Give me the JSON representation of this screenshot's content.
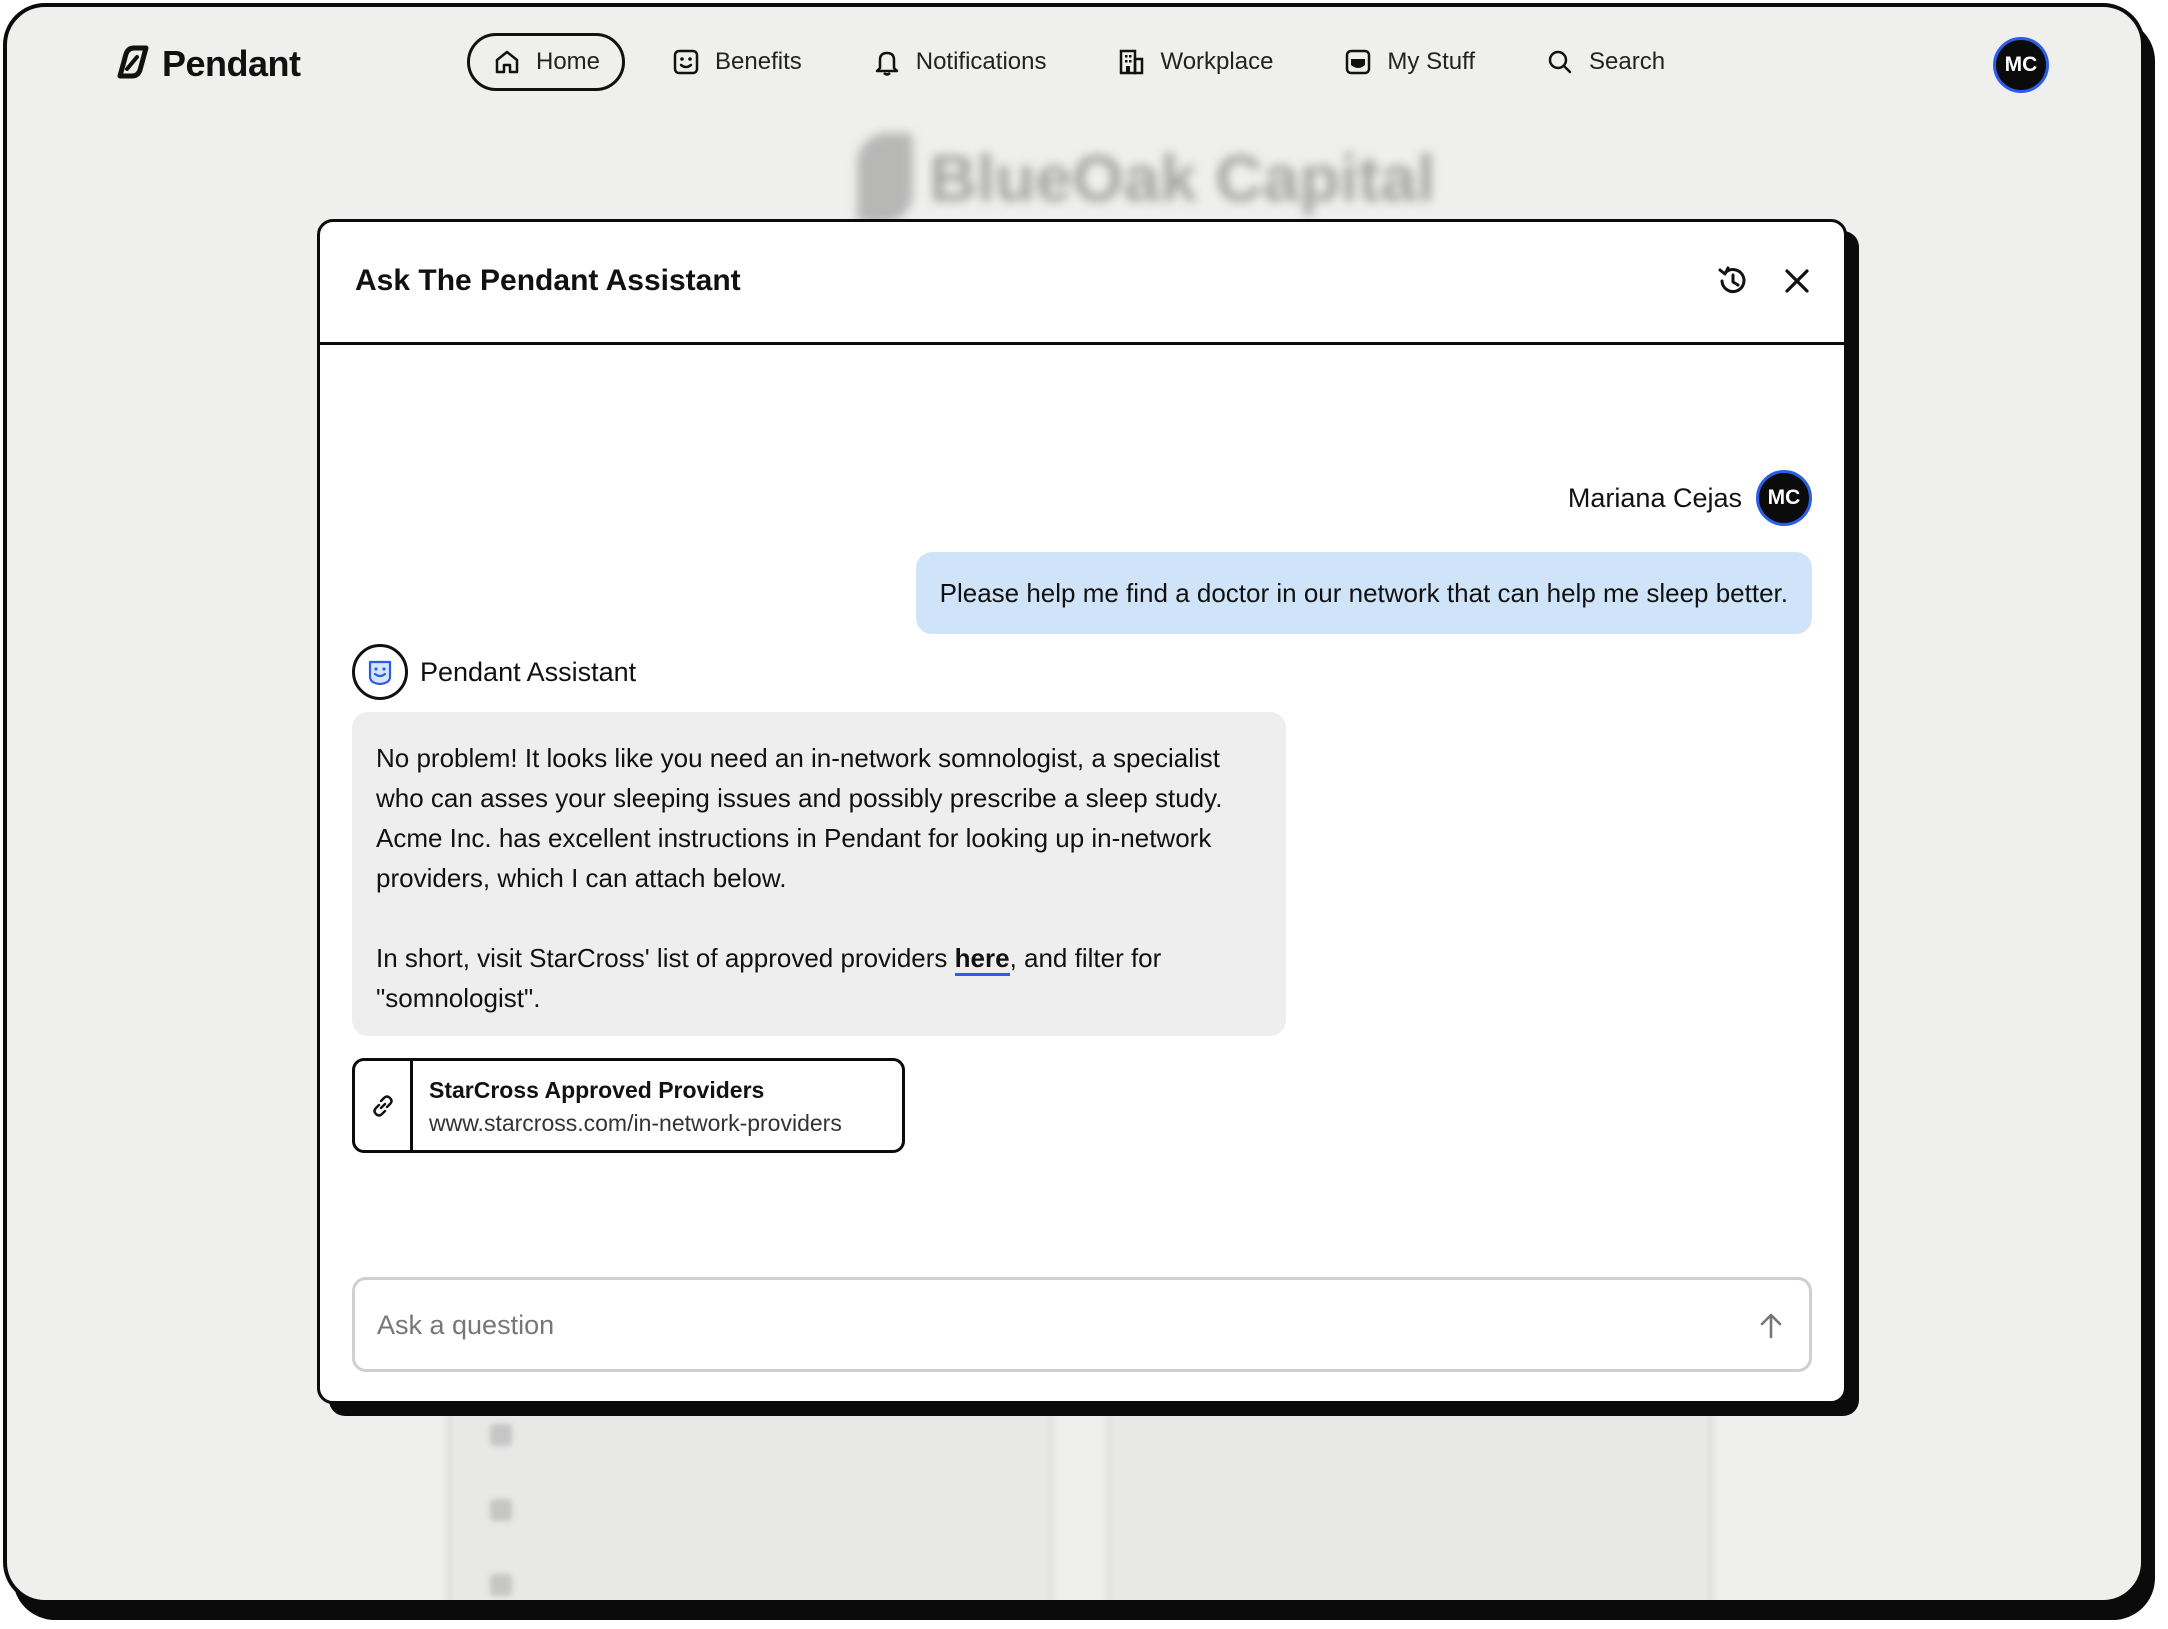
{
  "app": {
    "name": "Pendant"
  },
  "nav": {
    "items": [
      {
        "label": "Home",
        "icon": "home-icon",
        "active": true
      },
      {
        "label": "Benefits",
        "icon": "benefits-icon"
      },
      {
        "label": "Notifications",
        "icon": "bell-icon"
      },
      {
        "label": "Workplace",
        "icon": "building-icon"
      },
      {
        "label": "My Stuff",
        "icon": "my-stuff-icon"
      },
      {
        "label": "Search",
        "icon": "search-icon"
      }
    ],
    "avatar_initials": "MC"
  },
  "background": {
    "company_name": "BlueOak Capital"
  },
  "assistant_modal": {
    "title": "Ask The Pendant Assistant",
    "history_icon": "history-icon",
    "close_icon": "close-icon",
    "user": {
      "name": "Mariana Cejas",
      "initials": "MC"
    },
    "user_message": "Please help me find a doctor in our network that can help me sleep better.",
    "assistant": {
      "name": "Pendant Assistant",
      "icon": "pendant-bot-icon"
    },
    "assistant_message": {
      "paragraph1": "No problem! It looks like you need an in-network somnologist, a specialist who can asses your sleeping issues and possibly prescribe a sleep study. Acme Inc. has excellent instructions in Pendant for looking up in-network providers, which I can attach below.",
      "paragraph2_before": "In short, visit StarCross' list of approved providers ",
      "paragraph2_link": "here",
      "paragraph2_after": ", and filter for \"somnologist\"."
    },
    "link_card": {
      "icon": "link-icon",
      "title": "StarCross Approved Providers",
      "url": "www.starcross.com/in-network-providers"
    },
    "input": {
      "placeholder": "Ask a question",
      "value": ""
    },
    "send_icon": "arrow-up-icon"
  },
  "colors": {
    "accent_blue": "#2a5ee8",
    "user_bubble": "#cfe4f8",
    "assistant_bubble": "#eeeeee",
    "page_bg": "#efefee"
  }
}
